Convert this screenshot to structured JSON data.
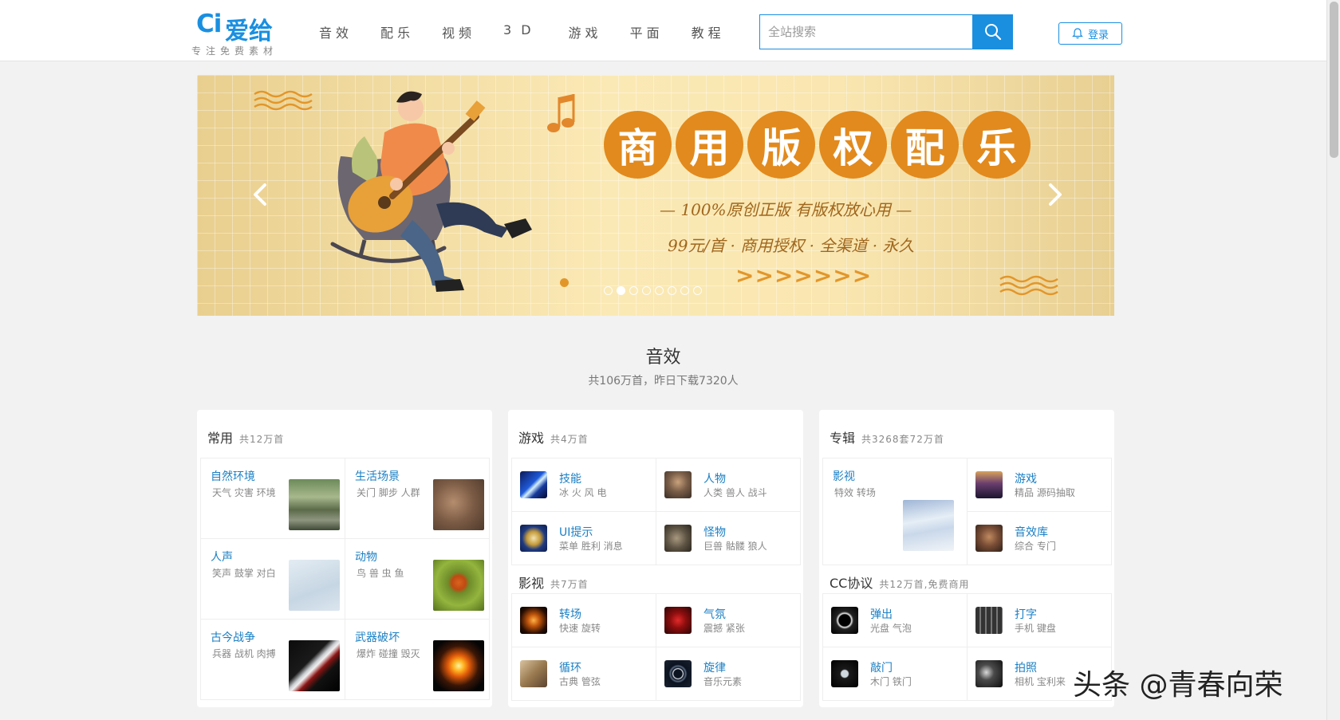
{
  "header": {
    "logo_mark": "Ci",
    "logo_name": "爱给",
    "slogan": "专注免费素材",
    "nav": [
      "音效",
      "配乐",
      "视频",
      "3D",
      "游戏",
      "平面",
      "教程"
    ],
    "search_placeholder": "全站搜索",
    "login_label": "登录"
  },
  "banner": {
    "title_chars": [
      "商",
      "用",
      "版",
      "权",
      "配",
      "乐"
    ],
    "subtitle1": "— 100%原创正版 有版权放心用 —",
    "subtitle2": "99元/首 · 商用授权 · 全渠道 · 永久",
    "chevrons": ">>>>>>>",
    "slide_count": 8,
    "active_slide": 2
  },
  "section": {
    "title": "音效",
    "subtitle": "共106万首，昨日下载7320人"
  },
  "cards": {
    "common": {
      "title": "常用",
      "count": "共12万首",
      "tiles": [
        {
          "title": "自然环境",
          "tags": "天气 灾害 环境"
        },
        {
          "title": "生活场景",
          "tags": "关门 脚步 人群"
        },
        {
          "title": "人声",
          "tags": "笑声 鼓掌 对白"
        },
        {
          "title": "动物",
          "tags": "鸟 兽 虫 鱼"
        },
        {
          "title": "古今战争",
          "tags": "兵器 战机 肉搏"
        },
        {
          "title": "武器破坏",
          "tags": "爆炸 碰撞 毁灭"
        }
      ]
    },
    "games": {
      "title": "游戏",
      "count": "共4万首",
      "items": [
        {
          "title": "技能",
          "tags": "冰 火 风 电"
        },
        {
          "title": "人物",
          "tags": "人类 兽人 战斗"
        },
        {
          "title": "UI提示",
          "tags": "菜单 胜利 消息"
        },
        {
          "title": "怪物",
          "tags": "巨兽 骷髅 狼人"
        }
      ]
    },
    "film": {
      "title": "影视",
      "count": "共7万首",
      "items": [
        {
          "title": "转场",
          "tags": "快速 旋转"
        },
        {
          "title": "气氛",
          "tags": "震撼 紧张"
        },
        {
          "title": "循环",
          "tags": "古典 管弦"
        },
        {
          "title": "旋律",
          "tags": "音乐元素"
        }
      ]
    },
    "albums": {
      "title": "专辑",
      "count": "共3268套72万首",
      "feature": {
        "title": "影视",
        "tags": "特效 转场"
      },
      "items": [
        {
          "title": "游戏",
          "tags": "精品 源码抽取"
        },
        {
          "title": "音效库",
          "tags": "综合 专门"
        }
      ]
    },
    "cc": {
      "title": "CC协议",
      "count": "共12万首,免费商用",
      "items": [
        {
          "title": "弹出",
          "tags": "光盘 气泡"
        },
        {
          "title": "打字",
          "tags": "手机 键盘"
        },
        {
          "title": "敲门",
          "tags": "木门 铁门"
        },
        {
          "title": "拍照",
          "tags": "相机 宝利来"
        }
      ]
    }
  },
  "watermark": "头条 @青春向荣",
  "colors": {
    "brand": "#1a8fe0",
    "banner_orange": "#e28a1d"
  }
}
